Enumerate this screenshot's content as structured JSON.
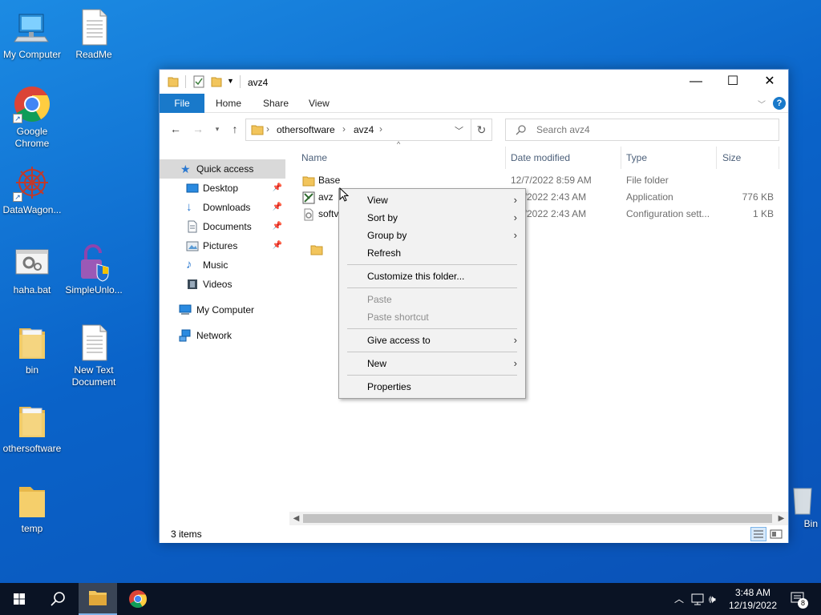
{
  "desktop": {
    "icons": [
      {
        "label": "My Computer"
      },
      {
        "label": "ReadMe"
      },
      {
        "label": "Google Chrome"
      },
      {
        "label": "DataWagon..."
      },
      {
        "label": "haha.bat"
      },
      {
        "label": "SimpleUnlo..."
      },
      {
        "label": "bin"
      },
      {
        "label": "New Text Document"
      },
      {
        "label": "othersoftware"
      },
      {
        "label": "temp"
      },
      {
        "label": "Bin"
      }
    ]
  },
  "window": {
    "title": "avz4",
    "ribbon_tabs": [
      "File",
      "Home",
      "Share",
      "View"
    ],
    "address": {
      "crumbs": [
        "othersoftware",
        "avz4"
      ]
    },
    "search": {
      "placeholder": "Search avz4"
    },
    "nav": {
      "quick_access": "Quick access",
      "items": [
        "Desktop",
        "Downloads",
        "Documents",
        "Pictures",
        "Music",
        "Videos"
      ],
      "my_computer": "My Computer",
      "network": "Network"
    },
    "columns": [
      "Name",
      "Date modified",
      "Type",
      "Size"
    ],
    "files": [
      {
        "name": "Base",
        "date": "12/7/2022 8:59 AM",
        "type": "File folder",
        "size": ""
      },
      {
        "name": "avz",
        "date": "9/2022 2:43 AM",
        "type": "Application",
        "size": "776 KB"
      },
      {
        "name": "softv",
        "date": "9/2022 2:43 AM",
        "type": "Configuration sett...",
        "size": "1 KB"
      }
    ],
    "status": "3 items"
  },
  "context_menu": {
    "items": [
      {
        "label": "View"
      },
      {
        "label": "Sort by"
      },
      {
        "label": "Group by"
      },
      {
        "label": "Refresh"
      },
      {
        "label": "Customize this folder..."
      },
      {
        "label": "Paste"
      },
      {
        "label": "Paste shortcut"
      },
      {
        "label": "Give access to"
      },
      {
        "label": "New"
      },
      {
        "label": "Properties"
      }
    ]
  },
  "taskbar": {
    "time": "3:48 AM",
    "date": "12/19/2022",
    "notifications": "8"
  }
}
